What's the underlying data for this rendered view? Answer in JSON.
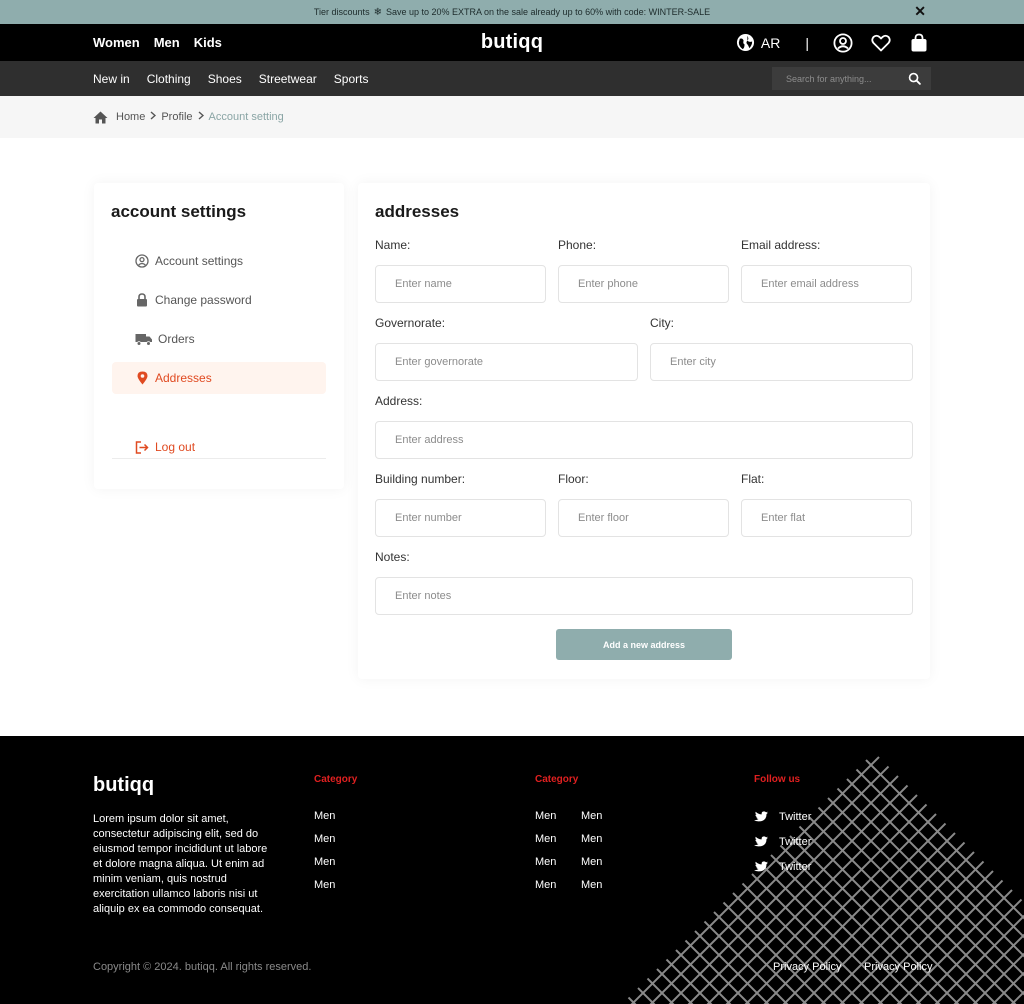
{
  "promo": {
    "text_left": "Tier discounts",
    "text_right": "Save up to 20% EXTRA on the sale already up to 60% with code: WINTER-SALE"
  },
  "header": {
    "gender_links": [
      "Women",
      "Men",
      "Kids"
    ],
    "logo": "butiqq",
    "language": "AR",
    "separator": "|"
  },
  "nav": {
    "categories": [
      "New in",
      "Clothing",
      "Shoes",
      "Streetwear",
      "Sports"
    ],
    "search_placeholder": "Search for anything..."
  },
  "breadcrumb": {
    "home": "Home",
    "profile": "Profile",
    "current": "Account setting"
  },
  "sidebar": {
    "title": "account settings",
    "items": [
      {
        "label": "Account settings",
        "icon": "user-circle-icon"
      },
      {
        "label": "Change password",
        "icon": "lock-icon"
      },
      {
        "label": "Orders",
        "icon": "truck-icon"
      },
      {
        "label": "Addresses",
        "icon": "map-pin-icon",
        "active": true
      }
    ],
    "logout": "Log out"
  },
  "form": {
    "title": "addresses",
    "name": {
      "label": "Name:",
      "placeholder": "Enter name"
    },
    "phone": {
      "label": "Phone:",
      "placeholder": "Enter phone"
    },
    "email": {
      "label": "Email address:",
      "placeholder": "Enter email address"
    },
    "governorate": {
      "label": "Governorate:",
      "placeholder": "Enter governorate"
    },
    "city": {
      "label": "City:",
      "placeholder": "Enter city"
    },
    "address": {
      "label": "Address:",
      "placeholder": "Enter address"
    },
    "building": {
      "label": "Building number:",
      "placeholder": "Enter number"
    },
    "floor": {
      "label": "Floor:",
      "placeholder": "Enter floor"
    },
    "flat": {
      "label": "Flat:",
      "placeholder": "Enter flat"
    },
    "notes": {
      "label": "Notes:",
      "placeholder": "Enter notes"
    },
    "submit": "Add a new address"
  },
  "footer": {
    "logo": "butiqq",
    "about": "Lorem ipsum dolor sit amet, consectetur adipiscing elit, sed do eiusmod tempor incididunt ut labore et dolore magna aliqua. Ut enim ad minim veniam, quis nostrud exercitation ullamco laboris nisi ut aliquip ex ea commodo consequat.",
    "col1": {
      "heading": "Category",
      "links": [
        "Men",
        "Men",
        "Men",
        "Men"
      ]
    },
    "col2": {
      "heading": "Category",
      "links_a": [
        "Men",
        "Men",
        "Men",
        "Men"
      ],
      "links_b": [
        "Men",
        "Men",
        "Men",
        "Men"
      ]
    },
    "follow": {
      "heading": "Follow us",
      "links": [
        "Twitter",
        "Twitter",
        "Twitter"
      ]
    },
    "copyright": "Copyright © 2024. butiqq. All rights reserved.",
    "policies": [
      "Privacy Policy",
      "Privacy Policy"
    ]
  },
  "colors": {
    "accent": "#8fadad",
    "active": "#e04a21",
    "footer_heading": "#e02020"
  }
}
